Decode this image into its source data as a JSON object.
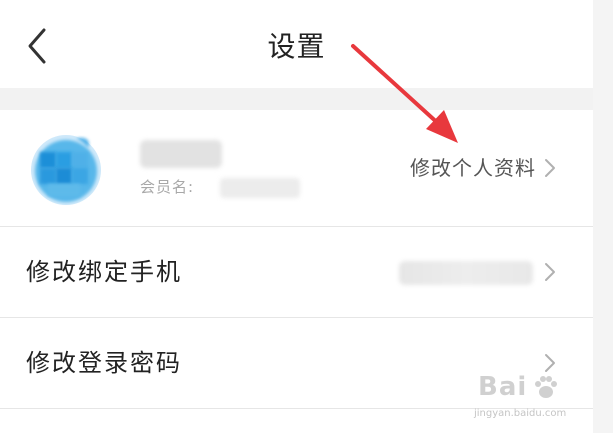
{
  "header": {
    "title": "设置"
  },
  "profile": {
    "member_label": "会员名:",
    "edit_label": "修改个人资料"
  },
  "rows": [
    {
      "label": "修改绑定手机"
    },
    {
      "label": "修改登录密码"
    }
  ],
  "icons": {
    "back": "chevron-left-icon",
    "chevron": "chevron-right-icon",
    "avatar": "avatar"
  },
  "colors": {
    "annotation_arrow": "#e8383d",
    "text_primary": "#222222",
    "text_secondary": "#555555",
    "text_muted": "#a8a8a8",
    "avatar_blue": "#2b9be0"
  },
  "watermark": {
    "brand": "Bai",
    "sub": "jingyan.baidu.com"
  }
}
